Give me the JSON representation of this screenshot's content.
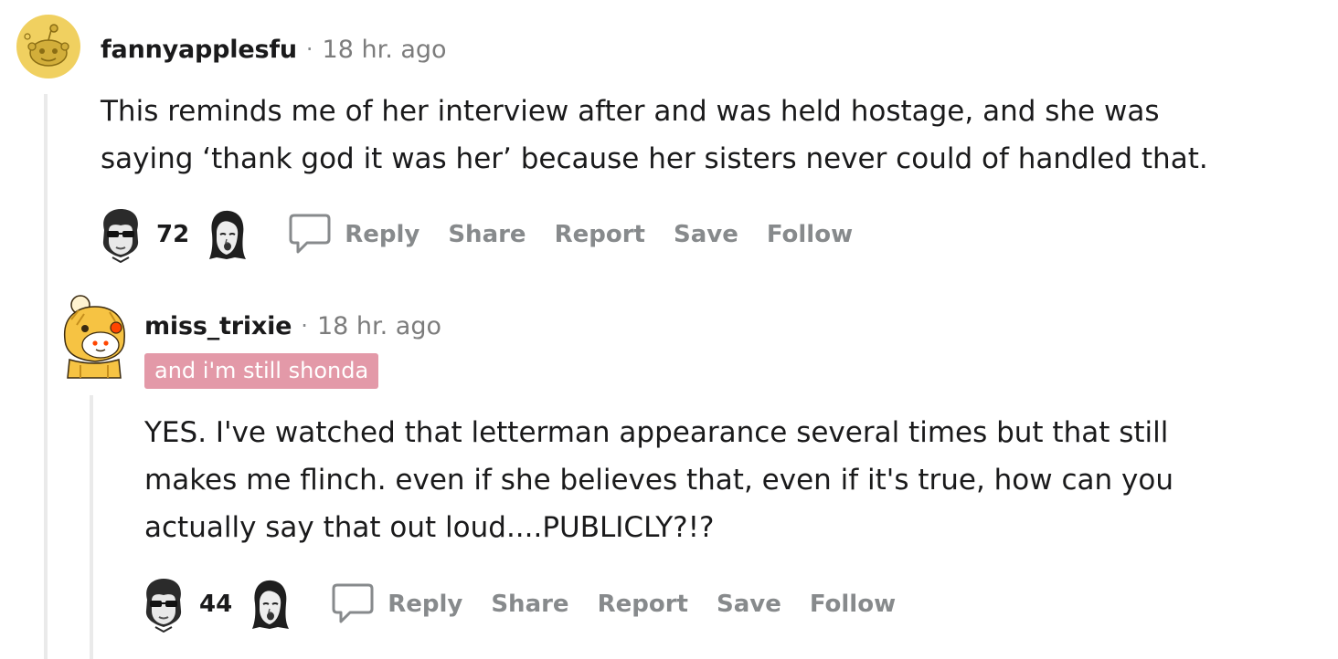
{
  "comments": [
    {
      "username": "fannyapplesfu",
      "separator": "·",
      "time": "18 hr. ago",
      "flair": "",
      "body": [
        "This reminds me of her interview after and was held hostage, and she was",
        "saying ‘thank god it was her’ because her sisters never could of handled that."
      ],
      "score": "72",
      "avatar_icon": "snoo-avatar-icon",
      "actions": {
        "reply": "Reply",
        "share": "Share",
        "report": "Report",
        "save": "Save",
        "follow": "Follow"
      }
    },
    {
      "username": "miss_trixie",
      "separator": "·",
      "time": "18 hr. ago",
      "flair": "and i'm still shonda",
      "body": [
        "YES. I've watched that letterman appearance several times but that still",
        "makes me flinch. even if she believes that, even if it's true, how can you",
        "actually say that out loud....PUBLICLY?!?"
      ],
      "score": "44",
      "avatar_icon": "snoo-costume-avatar-icon",
      "actions": {
        "reply": "Reply",
        "share": "Share",
        "report": "Report",
        "save": "Save",
        "follow": "Follow"
      }
    }
  ],
  "colors": {
    "flair_bg": "#e399a8",
    "action_text": "#878a8c",
    "thread_line": "#eaeaea",
    "text": "#1a1a1b"
  }
}
